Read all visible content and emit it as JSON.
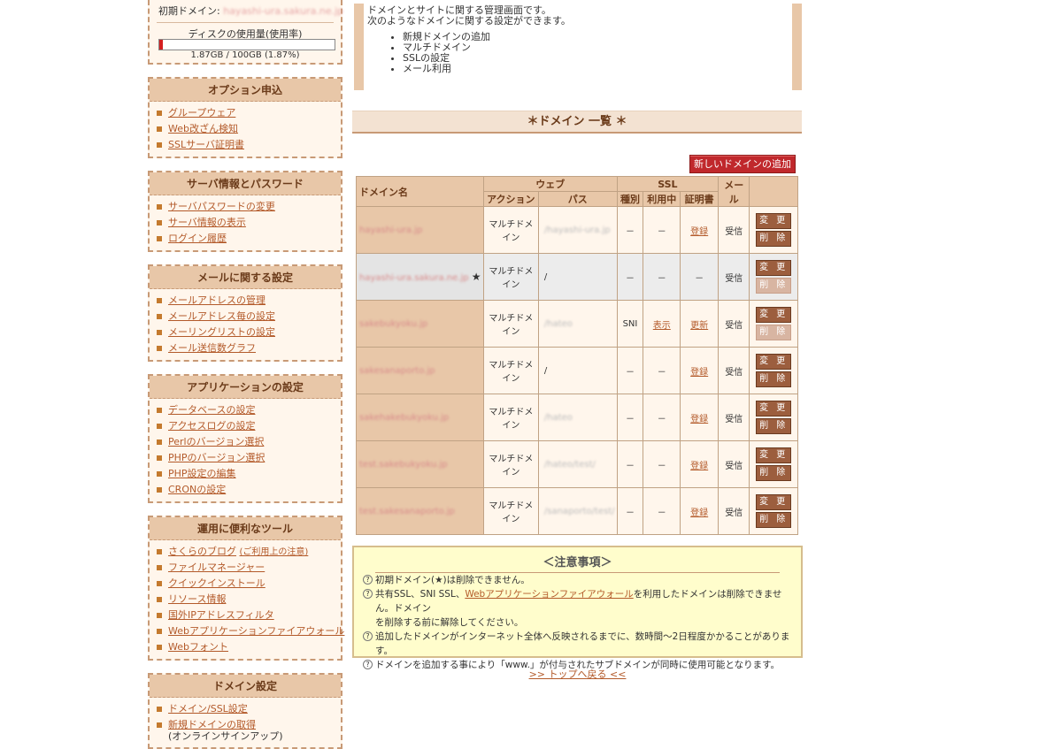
{
  "sidebar": {
    "top": {
      "domain_label": "初期ドメイン:",
      "domain_value": "hayashi-ura.sakura.ne.jp",
      "disk_label": "ディスクの使用量(使用率)",
      "disk_text": "1.87GB / 100GB (1.87%)",
      "disk_percent": 1.87
    },
    "panels": [
      {
        "title": "オプション申込",
        "items": [
          "グループウェア",
          "Web改ざん検知",
          "SSLサーバ証明書"
        ]
      },
      {
        "title": "サーバ情報とパスワード",
        "items": [
          "サーバパスワードの変更",
          "サーバ情報の表示",
          "ログイン履歴"
        ]
      },
      {
        "title": "メールに関する設定",
        "items": [
          "メールアドレスの管理",
          "メールアドレス毎の設定",
          "メーリングリストの設定",
          "メール送信数グラフ"
        ]
      },
      {
        "title": "アプリケーションの設定",
        "items": [
          "データベースの設定",
          "アクセスログの設定",
          "Perlのバージョン選択",
          "PHPのバージョン選択",
          "PHP設定の編集",
          "CRONの設定"
        ]
      },
      {
        "title": "運用に便利なツール",
        "items": [
          "さくらのブログ",
          "ファイルマネージャー",
          "クイックインストール",
          "リソース情報",
          "国外IPアドレスフィルタ",
          "Webアプリケーションファイアウォール",
          "Webフォント"
        ],
        "blog_note": "(ご利用上の注意)"
      },
      {
        "title": "ドメイン設定",
        "items": [
          "ドメイン/SSL設定",
          "新規ドメインの取得"
        ],
        "signup_note": "(オンラインサインアップ)"
      }
    ]
  },
  "intro": {
    "line1": "ドメインとサイトに関する管理画面です。",
    "line2": "次のようなドメインに関する設定ができます。",
    "bullets": [
      "新規ドメインの追加",
      "マルチドメイン",
      "SSLの設定",
      "メール利用"
    ]
  },
  "section_title": "＊ドメイン 一覧 ＊",
  "add_button": "新しいドメインの追加",
  "table": {
    "headers": {
      "name": "ドメイン名",
      "web": "ウェブ",
      "ssl": "SSL",
      "mail": "メール",
      "action": "アクション",
      "path": "パス",
      "type": "種別",
      "in_use": "利用中",
      "cert": "証明書"
    },
    "rows": [
      {
        "domain": "hayashi-ura.jp",
        "action": "マルチドメイン",
        "path": "/hayashi-ura.jp",
        "type": "－",
        "in_use": "－",
        "cert": "登録",
        "mail": "受信",
        "edit": "変 更",
        "delete": "削 除"
      },
      {
        "domain": "hayashi-ura.sakura.ne.jp",
        "star": "★",
        "action": "マルチドメイン",
        "path": "/",
        "type": "－",
        "in_use": "－",
        "cert": "－",
        "mail": "受信",
        "edit": "変 更",
        "delete": "削 除"
      },
      {
        "domain": "sakebukyoku.jp",
        "action": "マルチドメイン",
        "path": "/hateo",
        "type": "SNI",
        "in_use": "表示",
        "cert": "更新",
        "mail": "受信",
        "edit": "変 更",
        "delete": "削 除"
      },
      {
        "domain": "sakesanaporto.jp",
        "action": "マルチドメイン",
        "path": "/",
        "type": "－",
        "in_use": "－",
        "cert": "登録",
        "mail": "受信",
        "edit": "変 更",
        "delete": "削 除"
      },
      {
        "domain": "sakehakebukyoku.jp",
        "action": "マルチドメイン",
        "path": "/hateo",
        "type": "－",
        "in_use": "－",
        "cert": "登録",
        "mail": "受信",
        "edit": "変 更",
        "delete": "削 除"
      },
      {
        "domain": "test.sakebukyoku.jp",
        "action": "マルチドメイン",
        "path": "/hateo/test/",
        "type": "－",
        "in_use": "－",
        "cert": "登録",
        "mail": "受信",
        "edit": "変 更",
        "delete": "削 除"
      },
      {
        "domain": "test.sakesanaporto.jp",
        "action": "マルチドメイン",
        "path": "/sanaporto/test/",
        "type": "－",
        "in_use": "－",
        "cert": "登録",
        "mail": "受信",
        "edit": "変 更",
        "delete": "削 除"
      }
    ]
  },
  "notice": {
    "title": "＜注意事項＞",
    "lines": [
      "初期ドメイン(★)は削除できません。",
      "共有SSL、SNI SSL、",
      "Webアプリケーションファイアウォール",
      "を利用したドメインは削除できません。ドメイン",
      "を削除する前に解除してください。",
      "追加したドメインがインターネット全体へ反映されるまでに、数時間～2日程度かかることがあります。",
      "ドメインを追加する事により「www.」が付与されたサブドメインが同時に使用可能となります。"
    ]
  },
  "top_link": ">> トップへ戻る <<"
}
